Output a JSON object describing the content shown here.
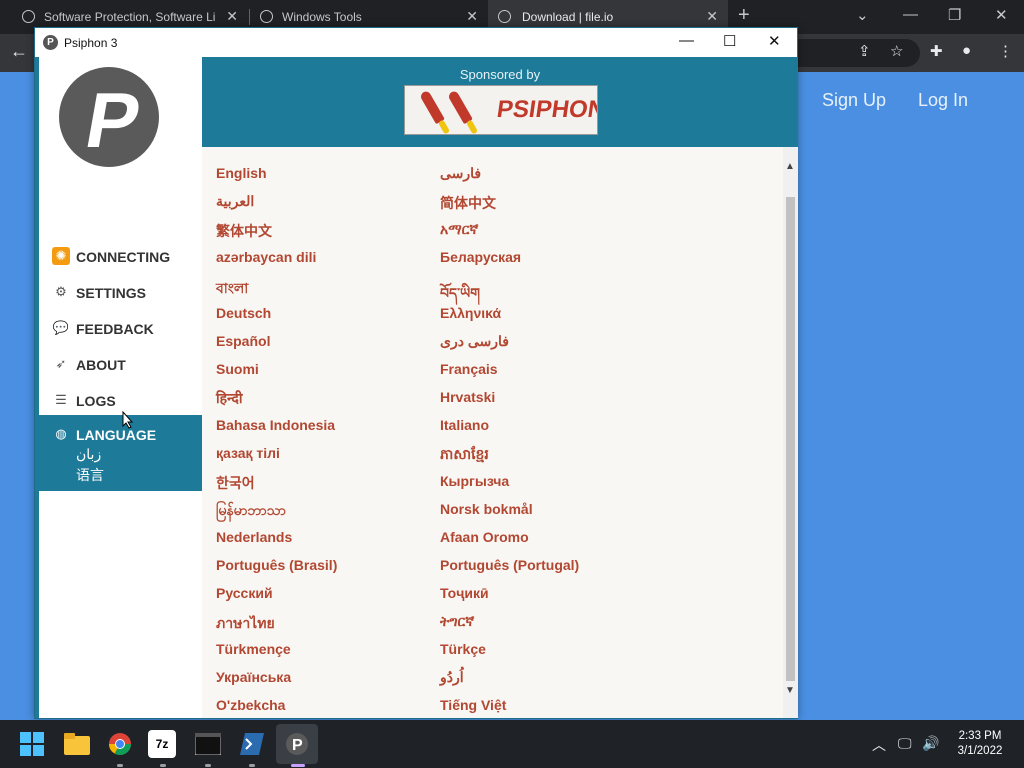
{
  "browser": {
    "tabs": [
      {
        "label": "Software Protection, Software Li",
        "active": false
      },
      {
        "label": "Windows Tools",
        "active": false
      },
      {
        "label": "Download | file.io",
        "active": true
      }
    ],
    "new_tab_symbol": "+"
  },
  "webpage": {
    "sign_up": "Sign Up",
    "log_in": "Log In"
  },
  "psiphon": {
    "title": "Psiphon 3",
    "logo_letter": "P",
    "nav": [
      {
        "label": "CONNECTING",
        "icon": "status-icon"
      },
      {
        "label": "SETTINGS",
        "icon": "gear-icon"
      },
      {
        "label": "FEEDBACK",
        "icon": "chat-icon"
      },
      {
        "label": "ABOUT",
        "icon": "rocket-icon"
      },
      {
        "label": "LOGS",
        "icon": "list-icon"
      },
      {
        "label": "LANGUAGE",
        "icon": "globe-icon",
        "sub1": "زبان",
        "sub2": "语言"
      }
    ],
    "sponsor_text": "Sponsored by",
    "sponsor_banner_text": "PSIPHON",
    "languages_left": [
      "English",
      "العربية",
      "繁体中文",
      "azərbaycan dili",
      "বাংলা",
      "Deutsch",
      "Español",
      "Suomi",
      "हिन्दी",
      "Bahasa Indonesia",
      "қазақ тілі",
      "한국어",
      "မြန်မာဘာသာ",
      "Nederlands",
      "Português (Brasil)",
      "Русский",
      "ภาษาไทย",
      "Türkmençe",
      "Українська",
      "O'zbekcha"
    ],
    "languages_right": [
      "فارسی",
      "简体中文",
      "አማርኛ",
      "Беларуская",
      "བོད་ཡིག",
      "Ελληνικά",
      "فارسی دری",
      "Français",
      "Hrvatski",
      "Italiano",
      "ភាសាខ្មែរ",
      "Кыргызча",
      "Norsk bokmål",
      "Afaan Oromo",
      "Português (Portugal)",
      "Тоҷикӣ",
      "ትግርኛ",
      "Türkçe",
      "اُردُو",
      "Tiếng Việt"
    ]
  },
  "taskbar": {
    "time": "2:33 PM",
    "date": "3/1/2022"
  },
  "colors": {
    "psiphon_teal": "#1d7a98",
    "language_link": "#b24732",
    "web_bg": "#4a8fe2"
  }
}
